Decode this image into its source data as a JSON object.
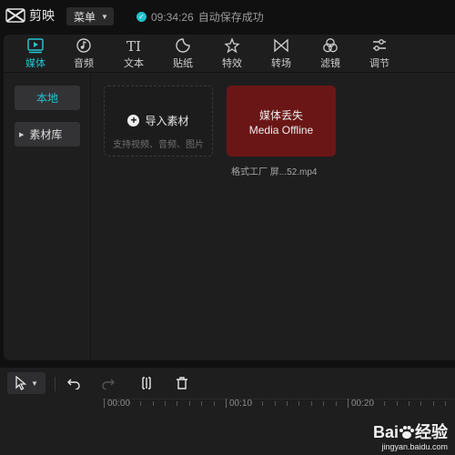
{
  "app": {
    "name": "剪映"
  },
  "titlebar": {
    "menu_label": "菜单",
    "save_time": "09:34:26",
    "save_text": "自动保存成功"
  },
  "toolbar": {
    "tools": [
      {
        "label": "媒体",
        "icon": "media-icon",
        "active": true
      },
      {
        "label": "音频",
        "icon": "music-note-icon",
        "active": false
      },
      {
        "label": "文本",
        "icon": "text-icon",
        "active": false
      },
      {
        "label": "贴纸",
        "icon": "sticker-icon",
        "active": false
      },
      {
        "label": "特效",
        "icon": "effects-star-icon",
        "active": false
      },
      {
        "label": "转场",
        "icon": "transition-icon",
        "active": false
      },
      {
        "label": "滤镜",
        "icon": "filter-circles-icon",
        "active": false
      },
      {
        "label": "调节",
        "icon": "adjust-sliders-icon",
        "active": false
      }
    ]
  },
  "sidebar": {
    "items": [
      {
        "label": "本地",
        "active": true
      },
      {
        "label": "素材库",
        "active": false
      }
    ]
  },
  "import": {
    "label": "导入素材",
    "sublabel": "支持视频、音频、图片"
  },
  "media_item": {
    "status_cn": "媒体丢失",
    "status_en": "Media Offline",
    "filename": "格式工厂 屏...52.mp4"
  },
  "timeline": {
    "ruler_labels": [
      "00:00",
      "00:10",
      "00:20"
    ]
  },
  "watermark": {
    "main_left": "Bai",
    "main_right": "经验",
    "sub": "jingyan.baidu.com"
  }
}
